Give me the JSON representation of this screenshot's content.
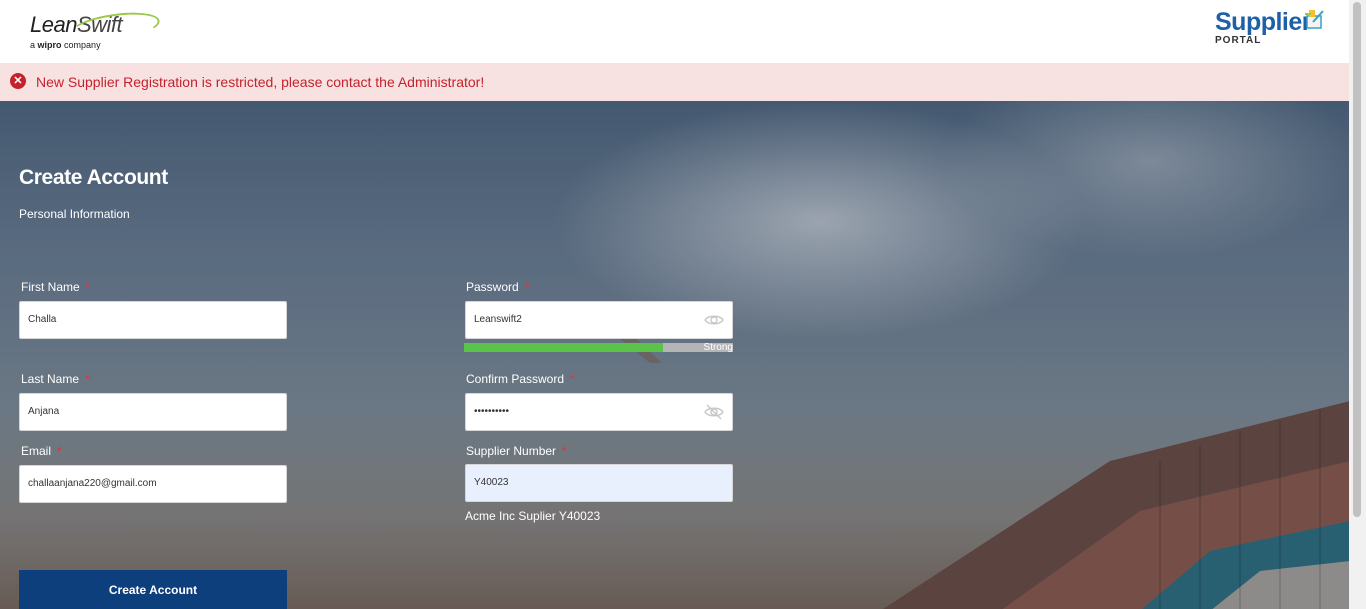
{
  "header": {
    "left_logo": {
      "brand": "LeanSwift",
      "brand_part1": "Lean",
      "brand_part2": "Swift",
      "tagline_pre": "a",
      "tagline_brand": "wipro",
      "tagline_post": "company"
    },
    "right_logo": {
      "brand": "Supplier",
      "sub": "PORTAL"
    }
  },
  "alert": {
    "icon": "error-circle-icon",
    "message": "New Supplier Registration is restricted, please contact the Administrator!",
    "color": "#c5222d"
  },
  "form": {
    "title": "Create Account",
    "section": "Personal Information",
    "required_mark": "*",
    "fields": {
      "first_name": {
        "label": "First Name",
        "value": "Challa"
      },
      "last_name": {
        "label": "Last Name",
        "value": "Anjana"
      },
      "email": {
        "label": "Email",
        "value": "challaanjana220@gmail.com"
      },
      "password": {
        "label": "Password",
        "value": "Leanswift2",
        "icon": "eye-icon"
      },
      "confirm_password": {
        "label": "Confirm Password",
        "value": "Leanswift2",
        "icon": "eye-slash-icon"
      },
      "supplier_number": {
        "label": "Supplier Number",
        "value": "Y40023",
        "resolved_name": "Acme Inc Suplier Y40023"
      }
    },
    "password_strength": {
      "label": "Strong",
      "level": 0.74,
      "color": "#5cc34a"
    },
    "submit_label": "Create Account"
  },
  "colors": {
    "primary": "#0d3f7d",
    "accent_brand": "#1e5fa8"
  }
}
